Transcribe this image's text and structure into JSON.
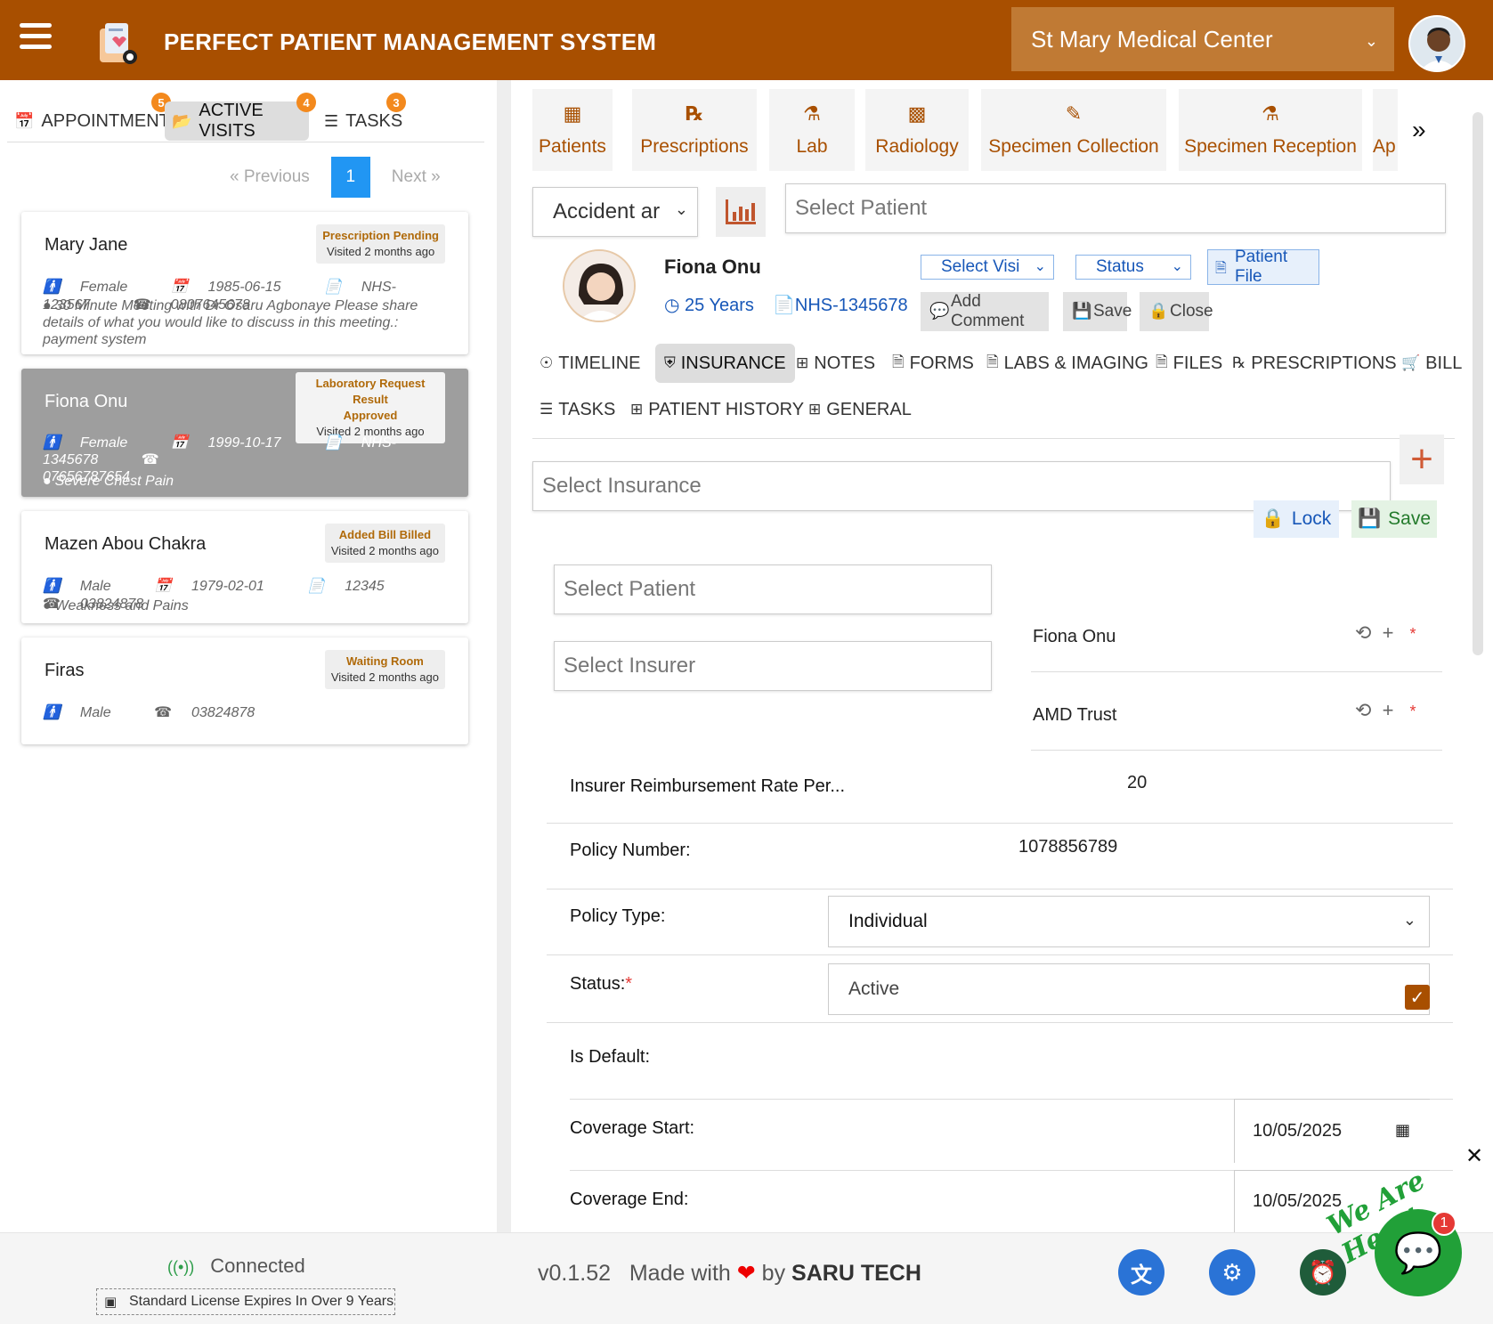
{
  "header": {
    "title": "PERFECT PATIENT MANAGEMENT SYSTEM",
    "organization": "St Mary Medical Center"
  },
  "left_tabs": [
    {
      "label": "APPOINTMENTS",
      "badge": "5"
    },
    {
      "label": "ACTIVE VISITS",
      "badge": "4"
    },
    {
      "label": "TASKS",
      "badge": "3"
    }
  ],
  "pager": {
    "prev": "« Previous",
    "page": "1",
    "next": "Next »"
  },
  "visits": [
    {
      "name": "Mary Jane",
      "status": "Prescription Pending",
      "visited": "Visited 2 months ago",
      "gender": "Female",
      "dob": "1985-06-15",
      "nhs": "NHS-123567",
      "phone": "0807645678",
      "note": "30 Minute Meeting with Dr Osaru Agbonaye Please share details of what you would like to discuss in this meeting.: payment system"
    },
    {
      "name": "Fiona Onu",
      "status_line1": "Laboratory Request Result",
      "status_line2": "Approved",
      "visited": "Visited 2 months ago",
      "gender": "Female",
      "dob": "1999-10-17",
      "nhs": "NHS-1345678",
      "phone": "07656787654",
      "note": "Severe Chest Pain"
    },
    {
      "name": "Mazen Abou Chakra",
      "status": "Added Bill Billed",
      "visited": "Visited 2 months ago",
      "gender": "Male",
      "dob": "1979-02-01",
      "nhs": "12345",
      "phone": "03824878",
      "note": "Weakness and Pains"
    },
    {
      "name": "Firas",
      "status": "Waiting Room",
      "visited": "Visited 2 months ago",
      "gender": "Male",
      "phone": "03824878"
    }
  ],
  "module_tabs": [
    "Patients",
    "Prescriptions",
    "Lab",
    "Radiology",
    "Specimen Collection",
    "Specimen Reception",
    "Ap"
  ],
  "filters": {
    "department": "Accident ar",
    "patient_placeholder": "Select  Patient"
  },
  "patient": {
    "name": "Fiona Onu",
    "age": "25 Years",
    "nhs": "NHS-1345678",
    "visit_select": "Select Visi",
    "status_select": "Status",
    "patient_file": "Patient File",
    "add_comment": "Add Comment",
    "save": "Save",
    "close": "Close"
  },
  "sub_tabs": [
    "TIMELINE",
    "INSURANCE",
    "NOTES",
    "FORMS",
    "LABS & IMAGING",
    "FILES",
    "PRESCRIPTIONS",
    "BILL",
    "TASKS",
    "PATIENT HISTORY",
    "GENERAL"
  ],
  "insurance": {
    "select_placeholder": "Select  Insurance",
    "lock": "Lock",
    "save": "Save",
    "patient_placeholder": "Select  Patient",
    "patient_value": "Fiona Onu",
    "insurer_placeholder": "Select  Insurer",
    "insurer_value": "AMD Trust",
    "rate_label": "Insurer Reimbursement Rate Per...",
    "rate_value": "20",
    "policy_number_label": "Policy Number:",
    "policy_number_value": "1078856789",
    "policy_type_label": "Policy Type:",
    "policy_type_value": "Individual",
    "status_label": "Status:",
    "status_value": "Active",
    "default_label": "Is Default:",
    "is_default": true,
    "coverage_start_label": "Coverage Start:",
    "coverage_start_value": "10/05/2025",
    "coverage_end_label": "Coverage End:",
    "coverage_end_value": "10/05/2025"
  },
  "footer": {
    "connection": "Connected",
    "license": "Standard License Expires In Over 9 Years",
    "version": "v0.1.52",
    "made_with": "Made with",
    "by": "by",
    "company": "SARU TECH",
    "chat_greeting": "We Are Here!",
    "chat_unread": "1"
  },
  "colors": {
    "brand": "#a84f00",
    "accent_blue": "#2196f3",
    "chat_green": "#21a038"
  }
}
